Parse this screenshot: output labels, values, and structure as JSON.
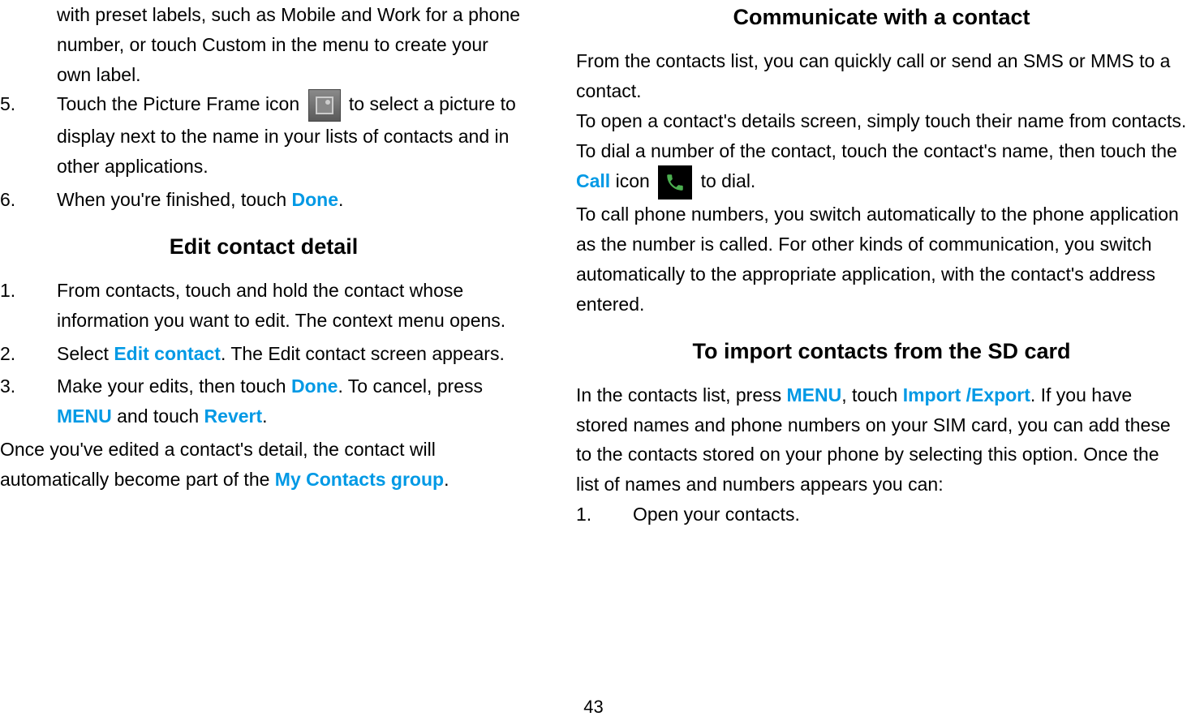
{
  "left": {
    "item4_continuation": "with preset labels, such as Mobile and Work for a phone number, or touch Custom in the menu to create your own label.",
    "item5_num": "5.",
    "item5_part1": "Touch the Picture Frame icon",
    "item5_part2": " to select a picture to display next to the name in your lists of contacts and in other applications.",
    "item6_num": "6.",
    "item6_part1": "When you're finished, touch ",
    "item6_done": "Done",
    "item6_part2": ".",
    "heading1": "Edit contact detail",
    "edit1_num": "1.",
    "edit1_text": "From contacts, touch and hold the contact whose information you want to edit. The context menu opens.",
    "edit2_num": "2.",
    "edit2_part1": "Select ",
    "edit2_highlight": "Edit contact",
    "edit2_part2": ". The Edit contact screen appears.",
    "edit3_num": "3.",
    "edit3_part1": "Make your edits, then touch ",
    "edit3_done": "Done",
    "edit3_part2": ". To cancel, press ",
    "edit3_menu": "MENU",
    "edit3_part3": " and touch ",
    "edit3_revert": "Revert",
    "edit3_part4": ".",
    "footer_part1": "Once you've edited a contact's detail, the contact will automatically become part of the ",
    "footer_highlight": "My Contacts group",
    "footer_part2": "."
  },
  "right": {
    "heading1": "Communicate with a contact",
    "para1": "From the contacts list, you can quickly call or send an SMS or MMS to a contact.",
    "para2": "To open a contact's details screen, simply touch their name from contacts.",
    "para3_part1": "To dial a number of the contact, touch the contact's name, then touch the ",
    "para3_call": "Call",
    "para3_part2": " icon ",
    "para3_part3": " to dial.",
    "para4": "To call phone numbers, you switch automatically to the phone application as the number is called. For other kinds of communication, you switch automatically to the appropriate application, with the contact's address entered.",
    "heading2": "To import contacts from the SD card",
    "import_part1": "In the contacts list, press ",
    "import_menu": "MENU",
    "import_part2": ", touch ",
    "import_export": "Import /Export",
    "import_part3": ". If you have stored names and phone numbers on your SIM card, you can add these to the contacts stored on your phone by selecting this option. Once the list of names and numbers appears you can:",
    "import1_num": "1.",
    "import1_text": "Open your contacts."
  },
  "page_number": "43"
}
